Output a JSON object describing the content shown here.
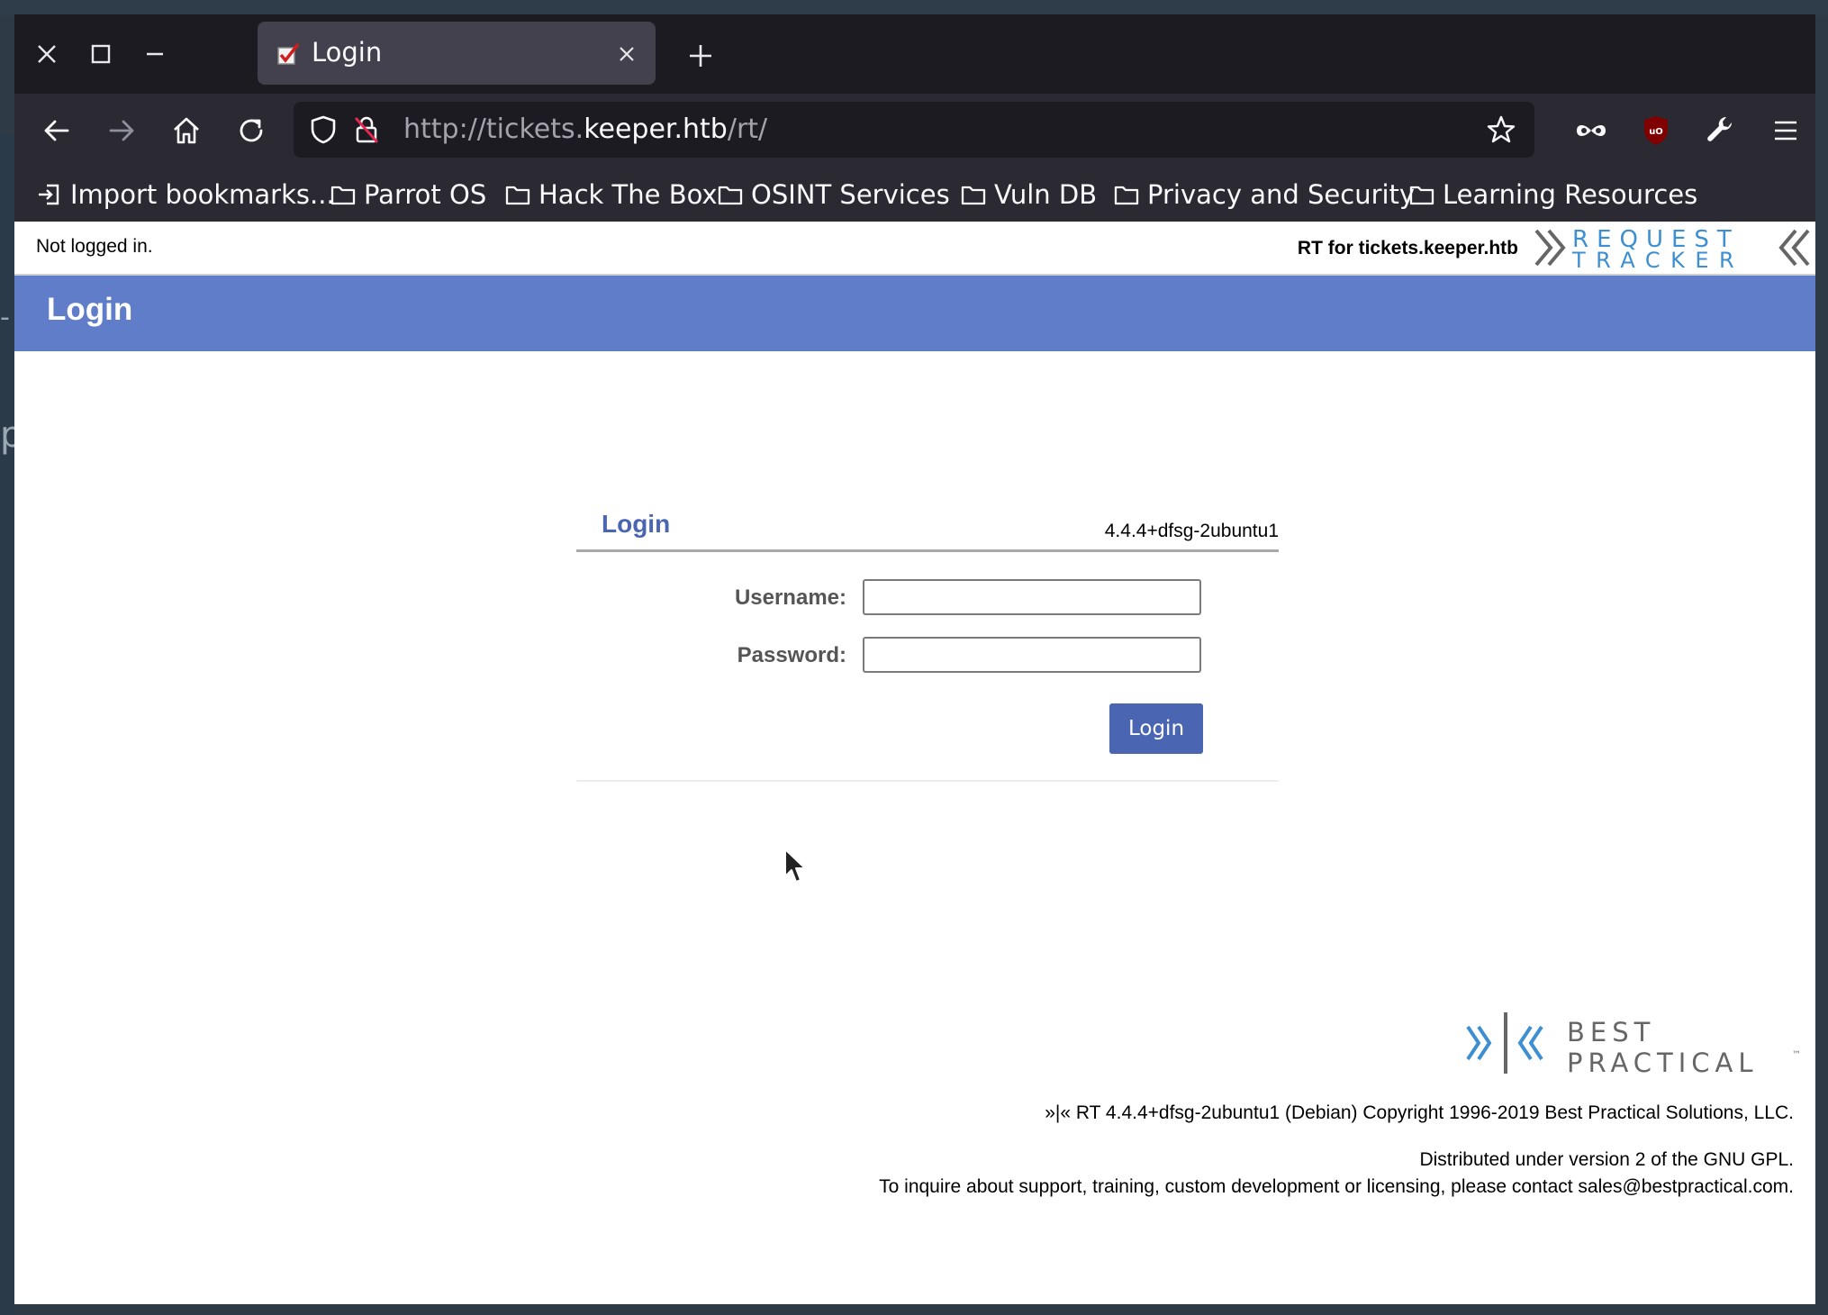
{
  "browser": {
    "tab": {
      "title": "Login"
    },
    "url": {
      "scheme": "http://tickets.",
      "domain": "keeper.htb",
      "path": "/rt/"
    },
    "bookmarks": [
      {
        "label": "Import bookmarks...",
        "icon": "import-icon"
      },
      {
        "label": "Parrot OS",
        "icon": "folder-icon"
      },
      {
        "label": "Hack The Box",
        "icon": "folder-icon"
      },
      {
        "label": "OSINT Services",
        "icon": "folder-icon"
      },
      {
        "label": "Vuln DB",
        "icon": "folder-icon"
      },
      {
        "label": "Privacy and Security",
        "icon": "folder-icon"
      },
      {
        "label": "Learning Resources",
        "icon": "folder-icon"
      }
    ]
  },
  "page": {
    "status": "Not logged in.",
    "rt_for": "RT for tickets.keeper.htb",
    "logo": {
      "line1": "REQUEST",
      "line2": "TRACKER"
    },
    "header_title": "Login",
    "login_box": {
      "title": "Login",
      "version": "4.4.4+dfsg-2ubuntu1",
      "username_label": "Username:",
      "username_value": "",
      "password_label": "Password:",
      "password_value": "",
      "button_label": "Login"
    },
    "footer": {
      "logo": {
        "line1": "BEST",
        "line2": "PRACTICAL",
        "tm": "™"
      },
      "copyright": "»|« RT 4.4.4+dfsg-2ubuntu1 (Debian) Copyright 1996-2019 Best Practical Solutions, LLC.",
      "license": "Distributed under version 2 of the GNU GPL.",
      "contact": "To inquire about support, training, custom development or licensing, please contact sales@bestpractical.com."
    }
  },
  "colors": {
    "titlebar": "#1c1b22",
    "toolbar": "#2b2a33",
    "header_blue": "#5f7dc8",
    "accent_blue": "#4a66b3",
    "logo_blue": "#3d8fd1"
  }
}
